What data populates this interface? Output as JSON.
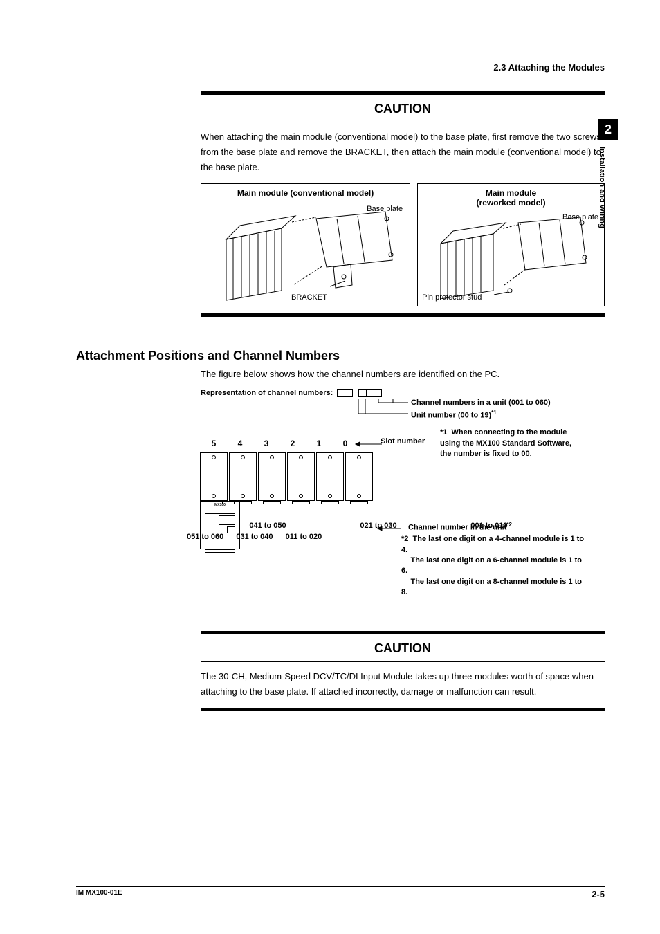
{
  "header": {
    "section_ref": "2.3  Attaching the Modules"
  },
  "side_tab": {
    "chapter_number": "2",
    "chapter_title": "Installation and Wiring"
  },
  "caution1": {
    "title": "CAUTION",
    "body": "When attaching the main module (conventional model) to the base plate, first remove the two screws from the base plate and remove the BRACKET, then attach the main module (conventional model) to the base plate.",
    "fig_left_title": "Main module (conventional model)",
    "fig_left_label_base": "Base plate",
    "fig_left_label_bracket": "BRACKET",
    "fig_right_title_l1": "Main module",
    "fig_right_title_l2": "(reworked model)",
    "fig_right_label_base": "Base plate",
    "fig_right_label_pin": "Pin protector stud"
  },
  "section": {
    "heading": "Attachment Positions and Channel Numbers",
    "intro": "The figure below shows how the channel numbers are identified on the PC.",
    "rep_label": "Representation of channel numbers:",
    "callout_ch_unit": "Channel numbers in a unit (001 to 060)",
    "callout_unit_no": "Unit number (00 to 19)",
    "callout_unit_sup": "*1",
    "note1_label": "*1",
    "note1_text": "When connecting to the module using the MX100 Standard Software, the number is fixed to 00.",
    "slot_label": "Slot number",
    "slots": [
      "5",
      "4",
      "3",
      "2",
      "1",
      "0"
    ],
    "device_label": "MX100",
    "ranges_top": [
      "041 to 050",
      "021 to 030",
      "001 to 010"
    ],
    "ranges_bot": [
      "051 to 060",
      "031 to 040",
      "011 to 020"
    ],
    "callout_ch_in_unit": "Channel number in the unit",
    "callout_ch_sup": "*2",
    "note2_label": "*2",
    "note2_l1": "The last one digit on a 4-channel module is 1 to 4.",
    "note2_l2": "The last one digit on a 6-channel module is 1 to 6.",
    "note2_l3": "The last one digit on a 8-channel module is 1 to 8."
  },
  "caution2": {
    "title": "CAUTION",
    "body": "The 30-CH, Medium-Speed DCV/TC/DI Input Module takes up three modules worth of space when attaching to the base plate. If attached incorrectly, damage or malfunction can result."
  },
  "footer": {
    "doc_id": "IM MX100-01E",
    "page": "2-5"
  }
}
